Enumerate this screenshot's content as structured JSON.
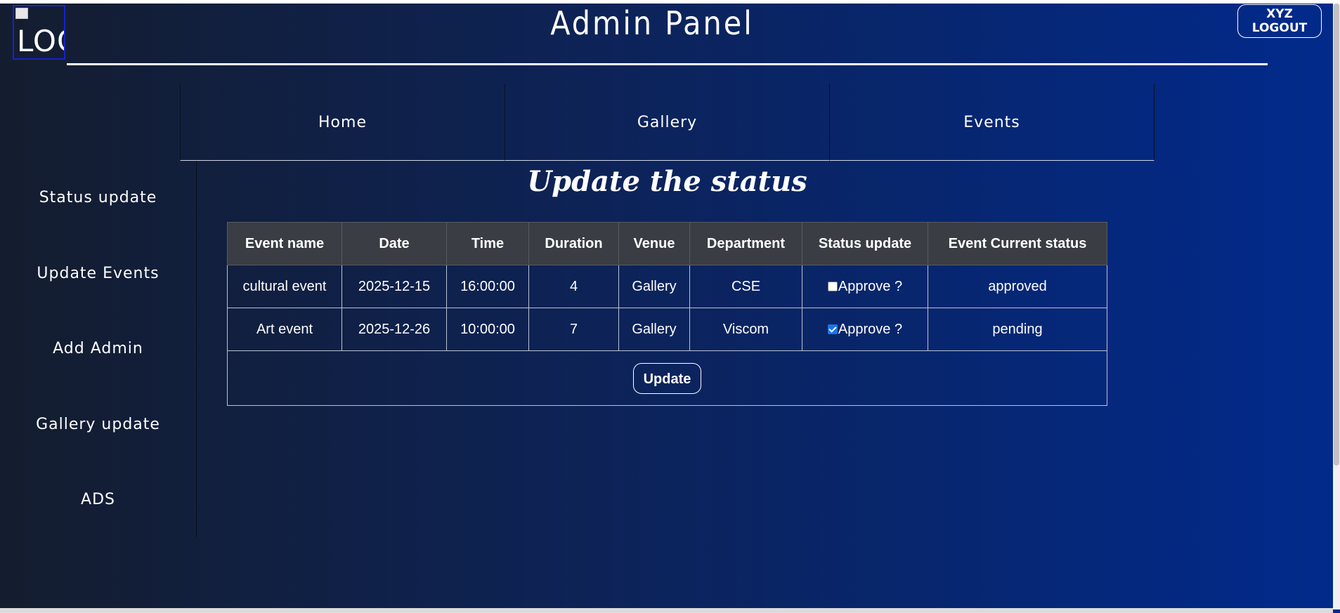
{
  "header": {
    "logo_alt": "LOG",
    "title": "Admin Panel",
    "logout_label": "XYZ LOGOUT"
  },
  "topnav": {
    "items": [
      {
        "label": "Home"
      },
      {
        "label": "Gallery"
      },
      {
        "label": "Events"
      }
    ]
  },
  "sidebar": {
    "items": [
      {
        "label": "Status update"
      },
      {
        "label": "Update Events"
      },
      {
        "label": "Add Admin"
      },
      {
        "label": "Gallery update"
      },
      {
        "label": "ADS"
      }
    ]
  },
  "main": {
    "heading": "Update the status",
    "table": {
      "headers": [
        "Event name",
        "Date",
        "Time",
        "Duration",
        "Venue",
        "Department",
        "Status update",
        "Event Current status"
      ],
      "rows": [
        {
          "event_name": "cultural event",
          "date": "2025-12-15",
          "time": "16:00:00",
          "duration": "4",
          "venue": "Gallery",
          "department": "CSE",
          "approve_label": "Approve ?",
          "approve_checked": false,
          "current_status": "approved"
        },
        {
          "event_name": "Art event",
          "date": "2025-12-26",
          "time": "10:00:00",
          "duration": "7",
          "venue": "Gallery",
          "department": "Viscom",
          "approve_label": "Approve ?",
          "approve_checked": true,
          "current_status": "pending"
        }
      ]
    },
    "update_label": "Update"
  },
  "colors": {
    "checkbox_checked": "#1a73e8",
    "table_header_bg": "#3a3d43",
    "logo_border": "#1a22c8"
  }
}
